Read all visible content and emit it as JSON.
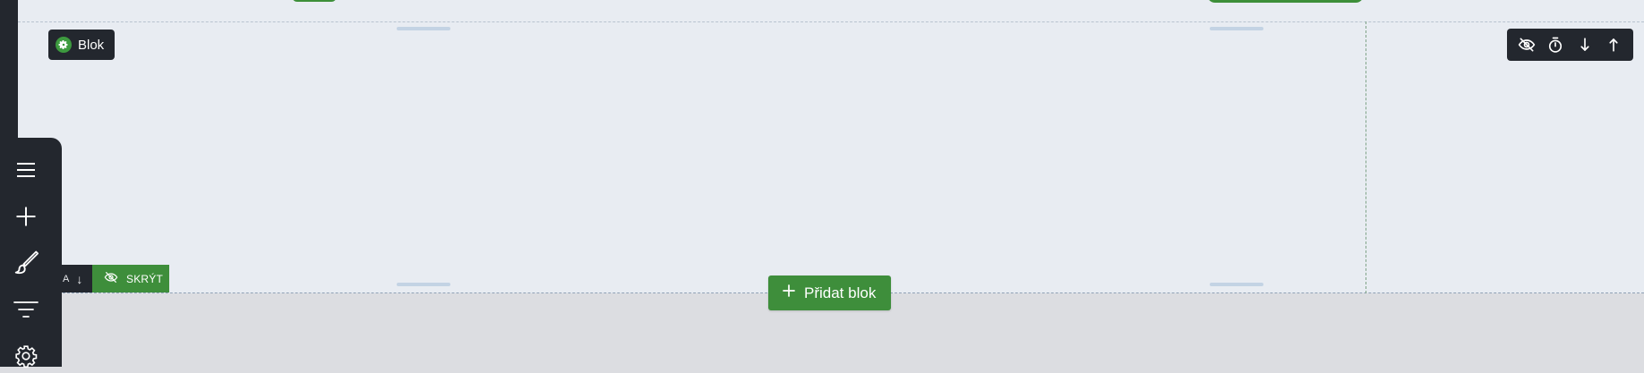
{
  "block_label": "Blok",
  "hide_button_label": "SKRÝT",
  "mini_toolbar": {
    "letter": "A",
    "arrow": "↓"
  },
  "add_block_label": "Přidat blok",
  "block_toolbar_icons": [
    "eye-slash-icon",
    "stopwatch-icon",
    "arrow-down-icon",
    "arrow-up-icon"
  ],
  "sidebar_icons": [
    "menu-icon",
    "plus-icon",
    "brush-icon",
    "filter-icon",
    "gear-icon"
  ],
  "colors": {
    "accent_green": "#3e8e3b",
    "dark": "#23272e",
    "canvas": "#e8ecf2",
    "background": "#dcdde1"
  }
}
